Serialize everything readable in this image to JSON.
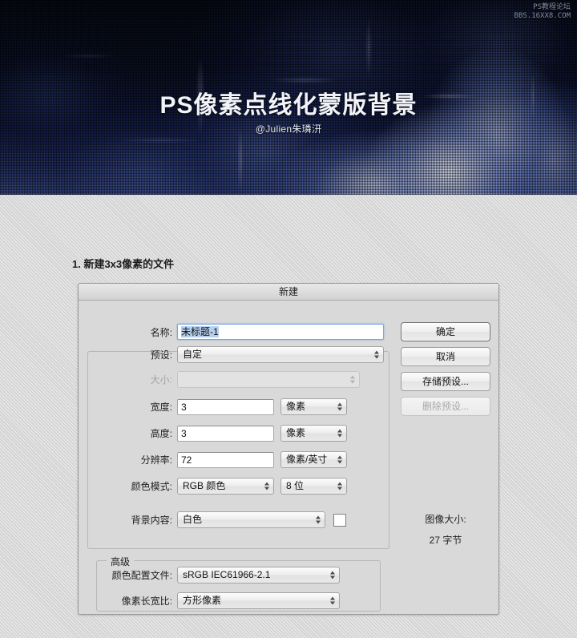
{
  "hero": {
    "title": "PS像素点线化蒙版背景",
    "subtitle": "@Julien朱璘汧",
    "watermark_line1": "PS教程论坛",
    "watermark_line2": "BBS.16XX8.COM"
  },
  "tutorial": {
    "step_heading": "1. 新建3x3像素的文件"
  },
  "dialog": {
    "title": "新建",
    "name": {
      "label": "名称:",
      "value": "未标题-1"
    },
    "preset": {
      "label": "预设:",
      "value": "自定"
    },
    "size": {
      "label": "大小:",
      "value": ""
    },
    "width": {
      "label": "宽度:",
      "value": "3",
      "unit": "像素"
    },
    "height": {
      "label": "高度:",
      "value": "3",
      "unit": "像素"
    },
    "resolution": {
      "label": "分辨率:",
      "value": "72",
      "unit": "像素/英寸"
    },
    "color_mode": {
      "label": "颜色模式:",
      "value": "RGB 颜色",
      "depth": "8 位"
    },
    "background_contents": {
      "label": "背景内容:",
      "value": "白色",
      "swatch_color": "#ffffff"
    },
    "advanced": {
      "title": "高级",
      "color_profile": {
        "label": "颜色配置文件:",
        "value": "sRGB IEC61966-2.1"
      },
      "pixel_aspect_ratio": {
        "label": "像素长宽比:",
        "value": "方形像素"
      }
    },
    "buttons": {
      "ok": "确定",
      "cancel": "取消",
      "save_preset": "存储预设...",
      "delete_preset": "删除预设..."
    },
    "image_size": {
      "label": "图像大小:",
      "value": "27 字节"
    }
  }
}
